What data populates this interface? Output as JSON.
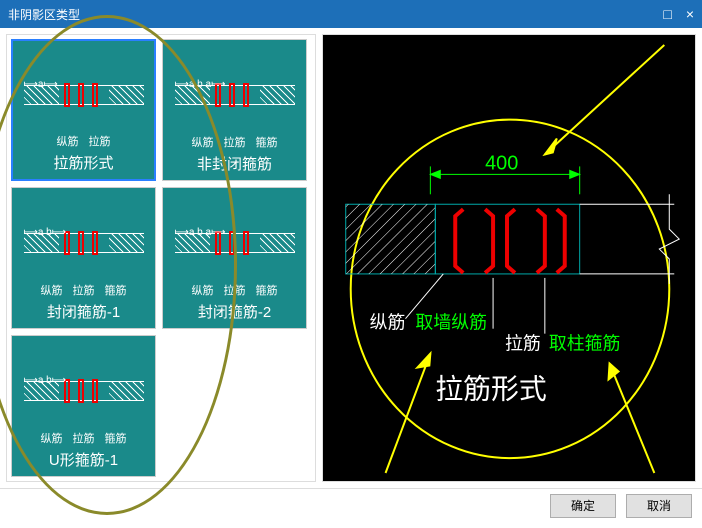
{
  "title": "非阴影区类型",
  "thumbs": [
    {
      "label": "拉筋形式",
      "subs": [
        "纵筋",
        "拉筋"
      ],
      "dim": "a",
      "selected": true
    },
    {
      "label": "非封闭箍筋",
      "subs": [
        "纵筋",
        "拉筋",
        "箍筋"
      ],
      "dim": "a   b   a"
    },
    {
      "label": "封闭箍筋-1",
      "subs": [
        "纵筋",
        "拉筋",
        "箍筋"
      ],
      "dim": "a   b"
    },
    {
      "label": "封闭箍筋-2",
      "subs": [
        "纵筋",
        "拉筋",
        "箍筋"
      ],
      "dim": "a  b  a"
    },
    {
      "label": "U形箍筋-1",
      "subs": [
        "纵筋",
        "拉筋",
        "箍筋"
      ],
      "dim": "a   b"
    }
  ],
  "preview": {
    "dim_value": "400",
    "label_zj": "纵筋",
    "label_qqzj": "取墙纵筋",
    "label_lj": "拉筋",
    "label_qzgj": "取柱箍筋",
    "title": "拉筋形式"
  },
  "buttons": {
    "ok": "确定",
    "cancel": "取消"
  }
}
